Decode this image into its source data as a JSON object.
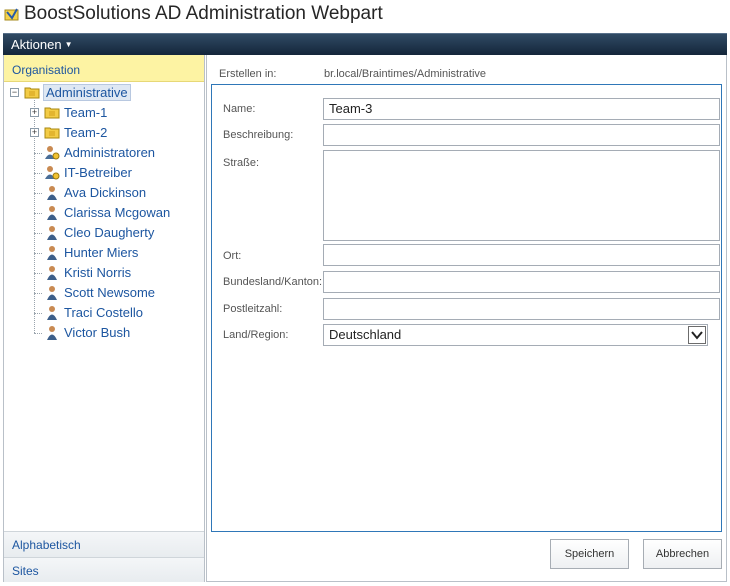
{
  "window": {
    "title": "BoostSolutions AD Administration Webpart"
  },
  "menu": {
    "actions_label": "Aktionen"
  },
  "sidebar": {
    "header": "Organisation",
    "tree": {
      "root": {
        "label": "Administrative",
        "expander": "−"
      },
      "children": [
        {
          "label": "Team-1",
          "type": "folder",
          "expander": "+"
        },
        {
          "label": "Team-2",
          "type": "folder",
          "expander": "+"
        },
        {
          "label": "Administratoren",
          "type": "group"
        },
        {
          "label": "IT-Betreiber",
          "type": "group"
        },
        {
          "label": "Ava Dickinson",
          "type": "user"
        },
        {
          "label": "Clarissa Mcgowan",
          "type": "user"
        },
        {
          "label": "Cleo Daugherty",
          "type": "user"
        },
        {
          "label": "Hunter Miers",
          "type": "user"
        },
        {
          "label": "Kristi Norris",
          "type": "user"
        },
        {
          "label": "Scott Newsome",
          "type": "user"
        },
        {
          "label": "Traci Costello",
          "type": "user"
        },
        {
          "label": "Victor Bush",
          "type": "user"
        }
      ]
    },
    "tabs": {
      "alphabetical": "Alphabetisch",
      "sites": "Sites"
    }
  },
  "form": {
    "created_in_label": "Erstellen in:",
    "created_in_value": "br.local/Braintimes/Administrative",
    "name_label": "Name:",
    "name_value": "Team-3",
    "description_label": "Beschreibung:",
    "description_value": "",
    "street_label": "Straße:",
    "street_value": "",
    "city_label": "Ort:",
    "city_value": "",
    "state_label": "Bundesland/Kanton:",
    "state_value": "",
    "zip_label": "Postleitzahl:",
    "zip_value": "",
    "country_label": "Land/Region:",
    "country_value": "Deutschland"
  },
  "buttons": {
    "save": "Speichern",
    "cancel": "Abbrechen"
  },
  "colors": {
    "menu_bar": "#1f344b",
    "link_blue": "#1d56a0",
    "org_header_bg": "#fdf3a3",
    "form_border": "#2f77b8"
  }
}
